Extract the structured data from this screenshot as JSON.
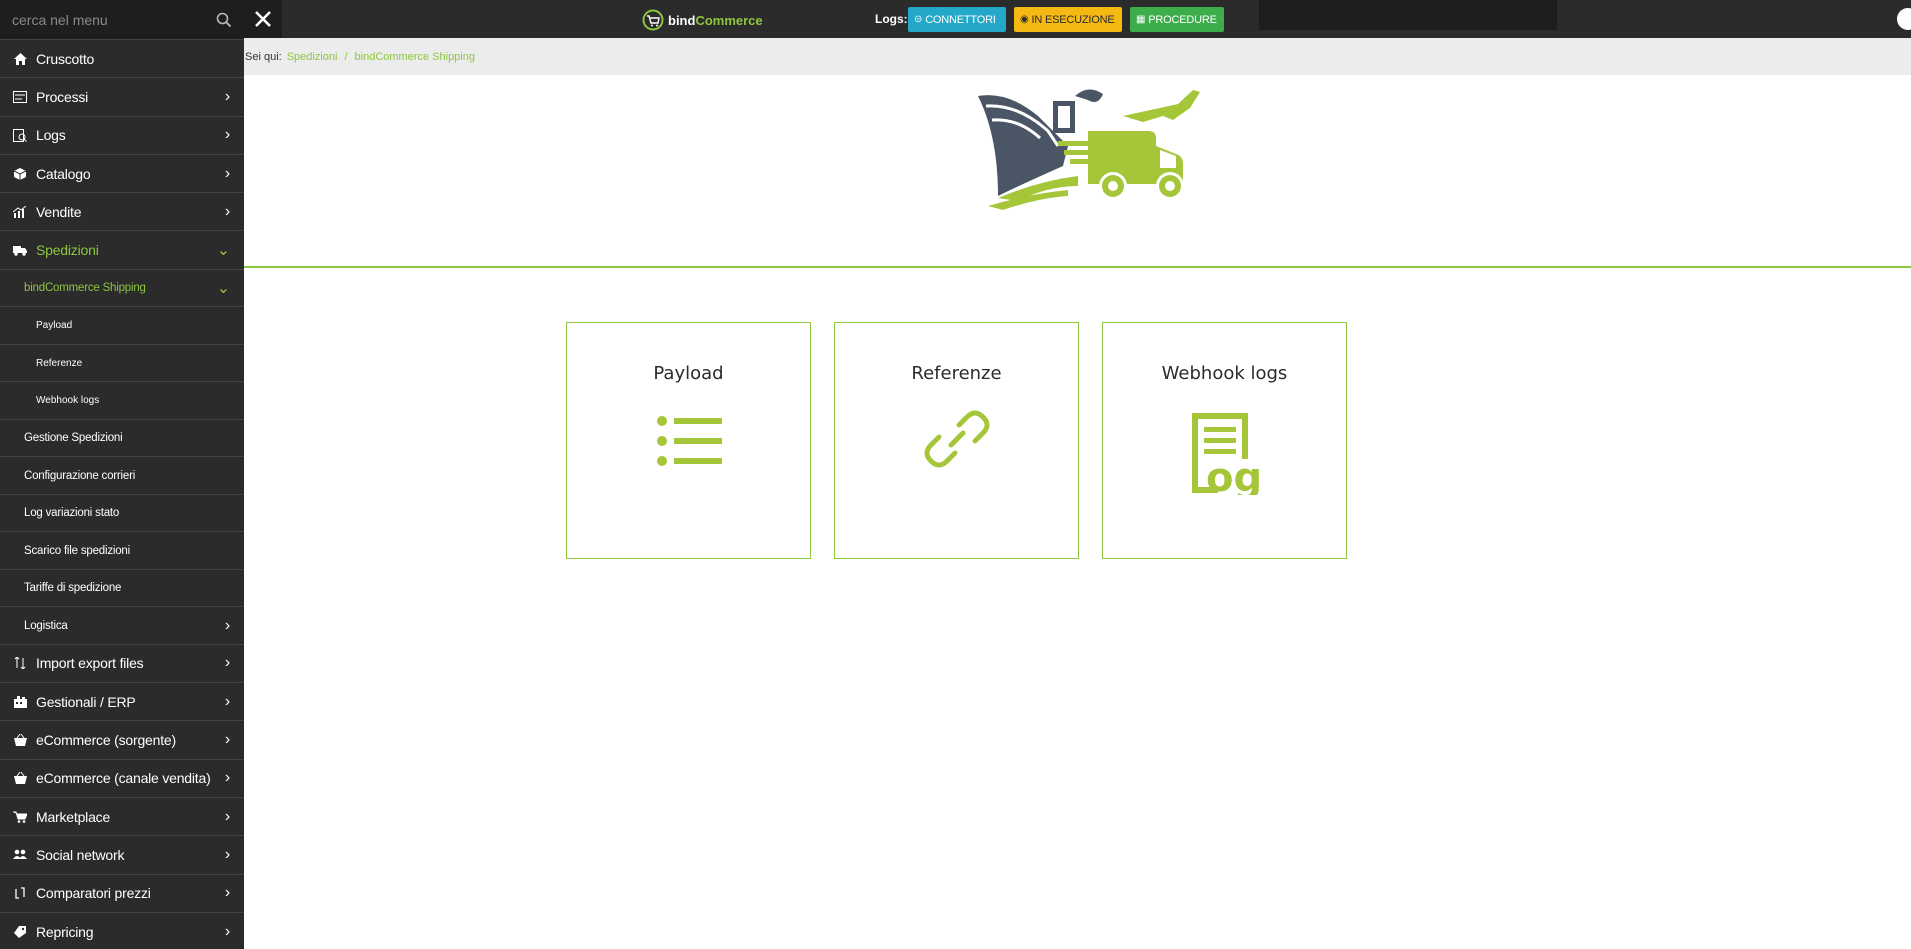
{
  "sidebar": {
    "search_placeholder": "cerca nel menu",
    "items": [
      {
        "label": "Cruscotto"
      },
      {
        "label": "Processi"
      },
      {
        "label": "Logs"
      },
      {
        "label": "Catalogo"
      },
      {
        "label": "Vendite"
      },
      {
        "label": "Spedizioni"
      }
    ],
    "shipping_group": "bindCommerce Shipping",
    "shipping_children": [
      "Payload",
      "Referenze",
      "Webhook logs"
    ],
    "spedizioni_children": [
      "Gestione Spedizioni",
      "Configurazione corrieri",
      "Log variazioni stato",
      "Scarico file spedizioni",
      "Tariffe di spedizione",
      "Logistica"
    ],
    "bottom_items": [
      {
        "label": "Import export files"
      },
      {
        "label": "Gestionali / ERP"
      },
      {
        "label": "eCommerce (sorgente)"
      },
      {
        "label": "eCommerce (canale vendita)"
      },
      {
        "label": "Marketplace"
      },
      {
        "label": "Social network"
      },
      {
        "label": "Comparatori prezzi"
      },
      {
        "label": "Repricing"
      }
    ]
  },
  "topbar": {
    "brand_bind": "bind",
    "brand_commerce": "Commerce",
    "logs_label": "Logs:",
    "btn_connettori": "CONNETTORI",
    "btn_esecuzione": "IN ESECUZIONE",
    "btn_procedure": "PROCEDURE"
  },
  "breadcrumb": {
    "label": "Sei qui:",
    "items": [
      "Spedizioni",
      "bindCommerce Shipping"
    ],
    "separator": "/"
  },
  "cards": [
    {
      "title": "Payload",
      "icon": "list-icon"
    },
    {
      "title": "Referenze",
      "icon": "link-icon"
    },
    {
      "title": "Webhook logs",
      "icon": "log-icon"
    }
  ],
  "colors": {
    "accent": "#8dc63f",
    "sidebar_bg": "#2b2b2b",
    "connettori": "#23a8c9",
    "esecuzione": "#f5b914",
    "procedure": "#3cad4a"
  }
}
